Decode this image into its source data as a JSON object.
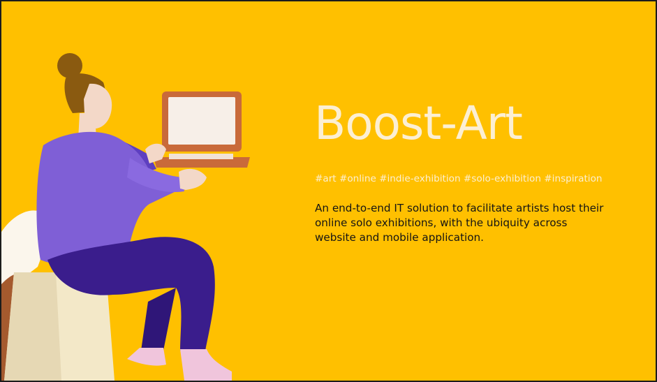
{
  "slide": {
    "title": "Boost-Art",
    "hashtags": "#art #online #indie-exhibition #solo-exhibition #inspiration",
    "description_lines": [
      "An end-to-end IT solution to facilitate artists  host their",
      "online solo exhibitions, with the ubiquity across",
      "website and mobile application."
    ]
  },
  "colors": {
    "background": "#FFC000",
    "title_text": "#fcefd2",
    "body_text": "#141414",
    "sweater": "#7f5fd6",
    "pants": "#3a1d8c",
    "hair": "#8a5a10",
    "laptop": "#c96a3a"
  },
  "illustration": {
    "icon": "woman-with-laptop-illustration"
  }
}
